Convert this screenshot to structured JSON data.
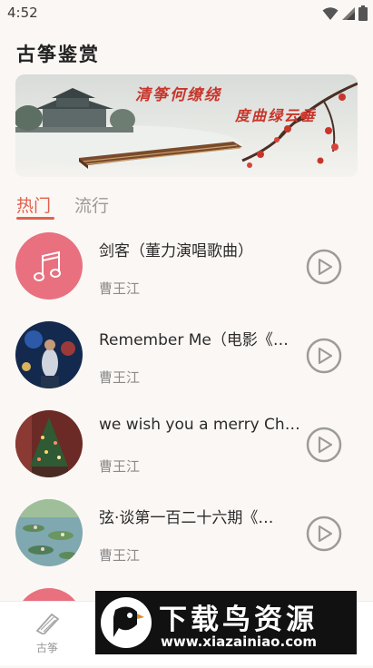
{
  "status_bar": {
    "time": "4:52"
  },
  "app": {
    "title": "古筝鉴赏"
  },
  "banner": {
    "line1": "清筝何缭绕",
    "line2": "度曲绿云垂"
  },
  "tabs": [
    {
      "label": "热门",
      "active": true
    },
    {
      "label": "流行",
      "active": false
    }
  ],
  "songs": [
    {
      "title": "剑客（董力演唱歌曲）",
      "artist": "曹王江",
      "cover": "music-note-icon"
    },
    {
      "title": "Remember Me（电影《寻梦环游记》主题曲）",
      "artist": "曹王江",
      "cover": "performer-photo"
    },
    {
      "title": "we wish you a merry Christmas",
      "artist": "曹王江",
      "cover": "christmas-tree-photo"
    },
    {
      "title": "弦·谈第一百二十六期《…",
      "artist": "曹王江",
      "cover": "water-lilies-painting"
    }
  ],
  "bottom_nav": {
    "items": [
      {
        "label": "古筝",
        "icon": "guzheng-icon"
      }
    ]
  },
  "watermark": {
    "title": "下载鸟资源",
    "url": "www.xiazainiao.com"
  },
  "colors": {
    "accent": "#e0614c",
    "background": "#fbf7f4",
    "cover_pink": "#e8707f"
  }
}
